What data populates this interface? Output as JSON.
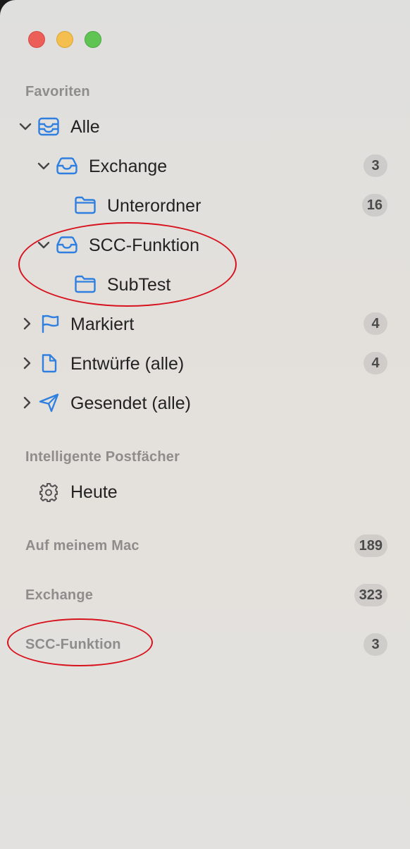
{
  "sidebar": {
    "favorites_header": "Favoriten",
    "items": [
      {
        "label": "Alle",
        "icon": "tray-stack-icon",
        "badge": ""
      },
      {
        "label": "Exchange",
        "icon": "tray-icon",
        "badge": "3"
      },
      {
        "label": "Unterordner",
        "icon": "folder-icon",
        "badge": "16"
      },
      {
        "label": "SCC-Funktion",
        "icon": "tray-icon",
        "badge": ""
      },
      {
        "label": "SubTest",
        "icon": "folder-icon",
        "badge": ""
      },
      {
        "label": "Markiert",
        "icon": "flag-icon",
        "badge": "4"
      },
      {
        "label": "Entwürfe (alle)",
        "icon": "document-icon",
        "badge": "4"
      },
      {
        "label": "Gesendet (alle)",
        "icon": "paper-plane-icon",
        "badge": ""
      }
    ],
    "smart_header": "Intelligente Postfächer",
    "smart_items": [
      {
        "label": "Heute",
        "icon": "gear-icon"
      }
    ],
    "accounts": [
      {
        "label": "Auf meinem Mac",
        "badge": "189"
      },
      {
        "label": "Exchange",
        "badge": "323"
      },
      {
        "label": "SCC-Funktion",
        "badge": "3"
      }
    ]
  },
  "colors": {
    "accent": "#2f7fe0",
    "annotation": "#d7121d",
    "section_text": "#8e8d8b"
  }
}
